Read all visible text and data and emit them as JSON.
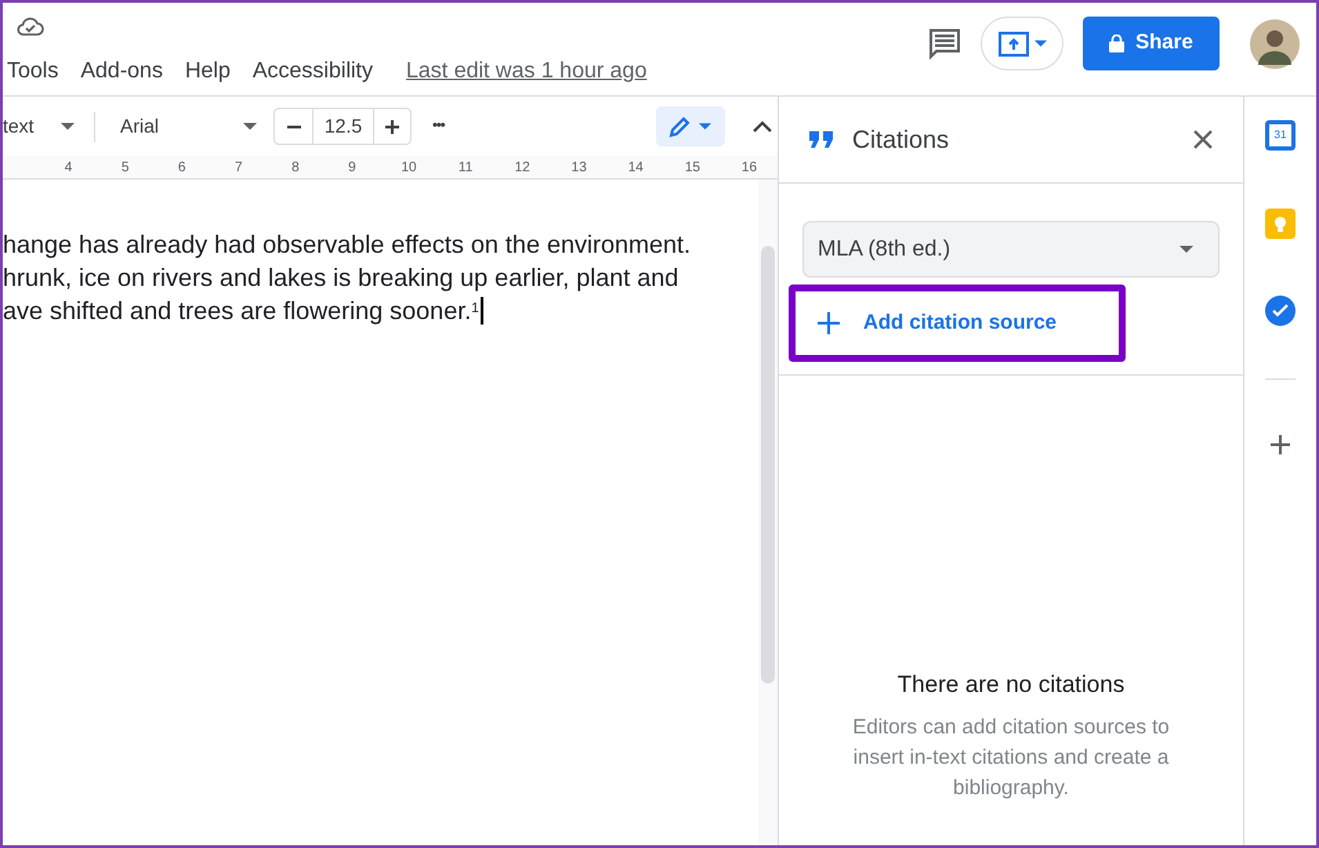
{
  "menu": [
    "Tools",
    "Add-ons",
    "Help",
    "Accessibility"
  ],
  "last_edit": "Last edit was 1 hour ago",
  "share_button": "Share",
  "toolbar": {
    "style": "text",
    "font": "Arial",
    "font_size": "12.5",
    "more": "•••"
  },
  "ruler": [
    "4",
    "5",
    "6",
    "7",
    "8",
    "9",
    "10",
    "11",
    "12",
    "13",
    "14",
    "15",
    "16"
  ],
  "document": [
    "hange has already had observable effects on the environment.",
    "hrunk, ice on rivers and lakes is breaking up earlier, plant and",
    "ave shifted and trees are flowering sooner.$^{1}$"
  ],
  "citations": {
    "title": "Citations",
    "style": "MLA (8th ed.)",
    "add_button": "Add citation source",
    "empty_title": "There are no citations",
    "empty_text": "Editors can add citation sources to insert in-text citations and create a bibliography."
  },
  "side_apps": [
    {
      "kind": "calendar",
      "label": "31"
    },
    {
      "kind": "keep"
    },
    {
      "kind": "tasks"
    },
    {
      "kind": "add"
    }
  ]
}
